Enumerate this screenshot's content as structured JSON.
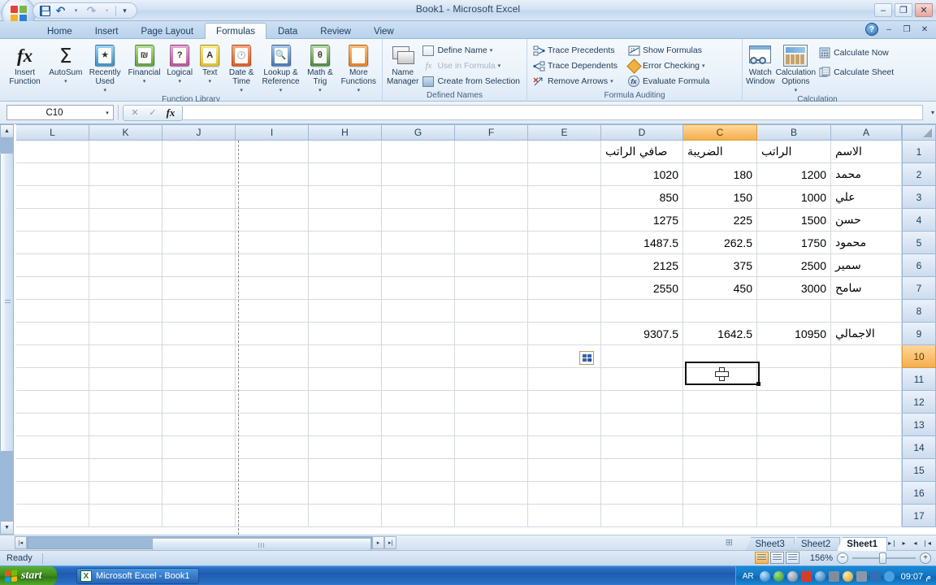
{
  "window": {
    "title": "Book1 - Microsoft Excel",
    "minimize": "–",
    "maximize": "❐",
    "close": "✕",
    "help": "?"
  },
  "quick_access": {
    "save": "save-icon",
    "undo": "↶",
    "redo": "↷",
    "more": "▾"
  },
  "ribbon": {
    "tabs": [
      {
        "label": "Home",
        "active": false
      },
      {
        "label": "Insert",
        "active": false
      },
      {
        "label": "Page Layout",
        "active": false
      },
      {
        "label": "Formulas",
        "active": true
      },
      {
        "label": "Data",
        "active": false
      },
      {
        "label": "Review",
        "active": false
      },
      {
        "label": "View",
        "active": false
      }
    ],
    "groups": [
      {
        "name": "Function Library",
        "label": "Function Library",
        "buttons": [
          {
            "label": "Insert Function",
            "icon": "fx-icon",
            "dropdown": false
          },
          {
            "label": "AutoSum",
            "icon": "sigma-icon",
            "dropdown": true
          },
          {
            "label": "Recently Used",
            "icon": "recently-used-book-icon",
            "dropdown": true
          },
          {
            "label": "Financial",
            "icon": "financial-book-icon",
            "dropdown": true
          },
          {
            "label": "Logical",
            "icon": "logical-book-icon",
            "dropdown": true
          },
          {
            "label": "Text",
            "icon": "text-book-icon",
            "dropdown": true
          },
          {
            "label": "Date & Time",
            "icon": "date-time-book-icon",
            "dropdown": true
          },
          {
            "label": "Lookup & Reference",
            "icon": "lookup-book-icon",
            "dropdown": true
          },
          {
            "label": "Math & Trig",
            "icon": "math-trig-book-icon",
            "dropdown": true
          },
          {
            "label": "More Functions",
            "icon": "more-functions-book-icon",
            "dropdown": true
          }
        ]
      },
      {
        "name": "Defined Names",
        "label": "Defined Names",
        "big": {
          "label": "Name Manager",
          "icon": "name-manager-icon"
        },
        "small": [
          {
            "label": "Define Name",
            "icon": "define-name-icon",
            "dropdown": true,
            "disabled": false
          },
          {
            "label": "Use in Formula",
            "icon": "use-in-formula-icon",
            "dropdown": true,
            "disabled": true
          },
          {
            "label": "Create from Selection",
            "icon": "create-from-selection-icon",
            "dropdown": false,
            "disabled": false
          }
        ]
      },
      {
        "name": "Formula Auditing",
        "label": "Formula Auditing",
        "col1": [
          {
            "label": "Trace Precedents",
            "icon": "trace-precedents-icon",
            "dropdown": false
          },
          {
            "label": "Trace Dependents",
            "icon": "trace-dependents-icon",
            "dropdown": false
          },
          {
            "label": "Remove Arrows",
            "icon": "remove-arrows-icon",
            "dropdown": true
          }
        ],
        "col2": [
          {
            "label": "Show Formulas",
            "icon": "show-formulas-icon",
            "dropdown": false
          },
          {
            "label": "Error Checking",
            "icon": "error-checking-icon",
            "dropdown": true
          },
          {
            "label": "Evaluate Formula",
            "icon": "evaluate-formula-icon",
            "dropdown": false
          }
        ]
      },
      {
        "name": "Calculation",
        "label": "Calculation",
        "big": {
          "label": "Watch Window",
          "icon": "watch-window-icon"
        },
        "big2": {
          "label": "Calculation Options",
          "icon": "calculation-options-icon",
          "dropdown": true
        },
        "small": [
          {
            "label": "Calculate Now",
            "icon": "calculate-now-icon"
          },
          {
            "label": "Calculate Sheet",
            "icon": "calculate-sheet-icon"
          }
        ]
      }
    ]
  },
  "formula_bar": {
    "name_box_value": "C10",
    "name_box_dropdown": "▾",
    "cancel": "✕",
    "enter": "✓",
    "insert_function": "fx",
    "formula_value": "",
    "expand": "▾"
  },
  "grid": {
    "column_headers": [
      "L",
      "K",
      "J",
      "I",
      "H",
      "G",
      "F",
      "E",
      "D",
      "C",
      "B",
      "A"
    ],
    "selected_column": "C",
    "row_headers": [
      "1",
      "2",
      "3",
      "4",
      "5",
      "6",
      "7",
      "8",
      "9",
      "10",
      "11",
      "12",
      "13",
      "14",
      "15",
      "16",
      "17"
    ],
    "selected_row": "10",
    "selected_cell": "C10",
    "table_headers": {
      "A": "الاسم",
      "B": "الراتب",
      "C": "الضريبة",
      "D": "صافي الراتب"
    },
    "rows": [
      {
        "row": "1",
        "A": "الاسم",
        "B": "الراتب",
        "C": "الضريبة",
        "D": "صافي الراتب"
      },
      {
        "row": "2",
        "A": "محمد",
        "B": "1200",
        "C": "180",
        "D": "1020"
      },
      {
        "row": "3",
        "A": "علي",
        "B": "1000",
        "C": "150",
        "D": "850"
      },
      {
        "row": "4",
        "A": "حسن",
        "B": "1500",
        "C": "225",
        "D": "1275"
      },
      {
        "row": "5",
        "A": "محمود",
        "B": "1750",
        "C": "262.5",
        "D": "1487.5"
      },
      {
        "row": "6",
        "A": "سمير",
        "B": "2500",
        "C": "375",
        "D": "2125"
      },
      {
        "row": "7",
        "A": "سامح",
        "B": "3000",
        "C": "450",
        "D": "2550"
      },
      {
        "row": "8",
        "A": "",
        "B": "",
        "C": "",
        "D": ""
      },
      {
        "row": "9",
        "A": "الاجمالي",
        "B": "10950",
        "C": "1642.5",
        "D": "9307.5"
      },
      {
        "row": "10",
        "A": "",
        "B": "",
        "C": "",
        "D": ""
      },
      {
        "row": "11",
        "A": "",
        "B": "",
        "C": "",
        "D": ""
      },
      {
        "row": "12",
        "A": "",
        "B": "",
        "C": "",
        "D": ""
      },
      {
        "row": "13",
        "A": "",
        "B": "",
        "C": "",
        "D": ""
      },
      {
        "row": "14",
        "A": "",
        "B": "",
        "C": "",
        "D": ""
      },
      {
        "row": "15",
        "A": "",
        "B": "",
        "C": "",
        "D": ""
      },
      {
        "row": "16",
        "A": "",
        "B": "",
        "C": "",
        "D": ""
      },
      {
        "row": "17",
        "A": "",
        "B": "",
        "C": "",
        "D": ""
      }
    ],
    "smart_tag": "paste-options-icon"
  },
  "sheet_tabs": {
    "tabs": [
      {
        "label": "Sheet3",
        "active": false
      },
      {
        "label": "Sheet2",
        "active": false
      },
      {
        "label": "Sheet1",
        "active": true
      }
    ],
    "nav": {
      "first": "▸❘",
      "prev": "▸",
      "next": "◂",
      "last": "❘◂"
    },
    "insert_sheet": "insert-worksheet-icon"
  },
  "status_bar": {
    "status": "Ready",
    "zoom": "156%",
    "zoom_out": "−",
    "zoom_in": "+",
    "views": [
      "normal-view",
      "page-layout-view",
      "page-break-preview"
    ]
  },
  "taskbar": {
    "start": "start",
    "task": "Microsoft Excel - Book1",
    "language": "AR",
    "time": "09:07 م"
  }
}
